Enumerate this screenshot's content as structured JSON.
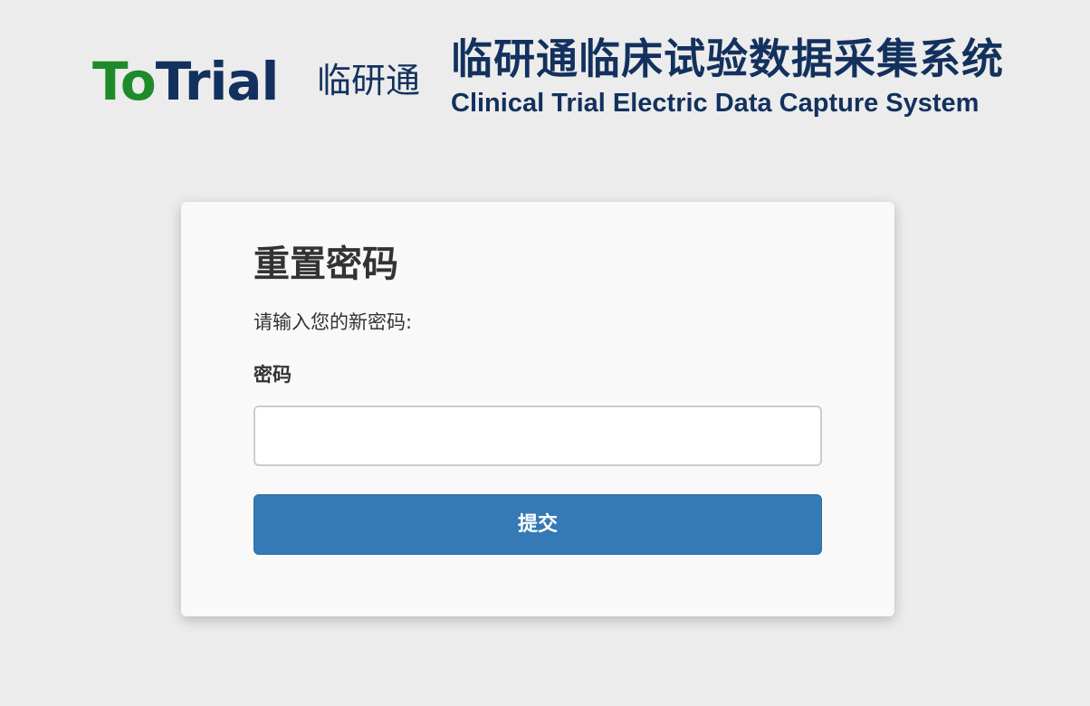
{
  "header": {
    "logo_part_to": "To",
    "logo_part_trial": "Trial",
    "logo_cn": "临研通",
    "system_title_cn": "临研通临床试验数据采集系统",
    "system_title_en": "Clinical Trial Electric Data Capture System"
  },
  "card": {
    "title": "重置密码",
    "instruction": "请输入您的新密码:",
    "password_label": "密码",
    "password_value": "",
    "password_placeholder": "",
    "submit_label": "提交"
  },
  "colors": {
    "background": "#ececec",
    "card_background": "#f9f9f9",
    "brand_green": "#1e8a2a",
    "brand_navy": "#13315e",
    "button_primary": "#337ab7",
    "text": "#333333"
  }
}
